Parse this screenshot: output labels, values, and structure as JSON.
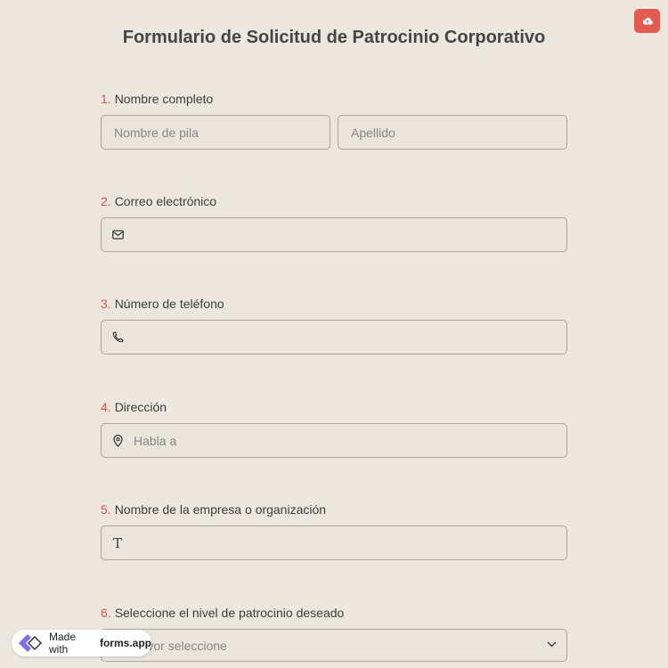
{
  "header": {
    "title": "Formulario de Solicitud de Patrocinio Corporativo",
    "save_icon": "cloud-upload-icon",
    "accent_color": "#e45a4f"
  },
  "questions": [
    {
      "number": "1.",
      "label": "Nombre completo",
      "fields": [
        {
          "placeholder": "Nombre de pila"
        },
        {
          "placeholder": "Apellido"
        }
      ]
    },
    {
      "number": "2.",
      "label": "Correo electrónico",
      "icon": "email-icon",
      "placeholder": ""
    },
    {
      "number": "3.",
      "label": "Número de teléfono",
      "icon": "phone-icon",
      "placeholder": ""
    },
    {
      "number": "4.",
      "label": "Dirección",
      "icon": "location-pin-icon",
      "placeholder": "Habla a"
    },
    {
      "number": "5.",
      "label": "Nombre de la empresa o organización",
      "icon": "text-icon",
      "icon_glyph": "T",
      "placeholder": ""
    },
    {
      "number": "6.",
      "label": "Seleccione el nivel de patrocinio deseado",
      "icon": "chevron-down-icon",
      "placeholder": "Por favor seleccione"
    }
  ],
  "badge": {
    "prefix": "Made with",
    "brand": "forms.app",
    "icon": "forms-app-logo-icon"
  }
}
